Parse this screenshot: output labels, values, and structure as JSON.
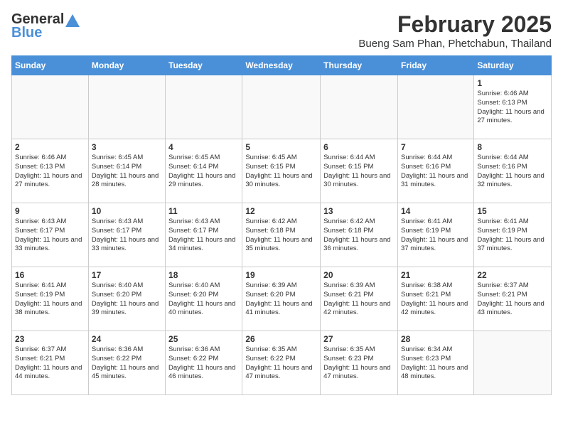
{
  "logo": {
    "general": "General",
    "blue": "Blue"
  },
  "title": "February 2025",
  "subtitle": "Bueng Sam Phan, Phetchabun, Thailand",
  "days_of_week": [
    "Sunday",
    "Monday",
    "Tuesday",
    "Wednesday",
    "Thursday",
    "Friday",
    "Saturday"
  ],
  "weeks": [
    [
      {
        "day": "",
        "info": ""
      },
      {
        "day": "",
        "info": ""
      },
      {
        "day": "",
        "info": ""
      },
      {
        "day": "",
        "info": ""
      },
      {
        "day": "",
        "info": ""
      },
      {
        "day": "",
        "info": ""
      },
      {
        "day": "1",
        "info": "Sunrise: 6:46 AM\nSunset: 6:13 PM\nDaylight: 11 hours and 27 minutes."
      }
    ],
    [
      {
        "day": "2",
        "info": "Sunrise: 6:46 AM\nSunset: 6:13 PM\nDaylight: 11 hours and 27 minutes."
      },
      {
        "day": "3",
        "info": "Sunrise: 6:45 AM\nSunset: 6:14 PM\nDaylight: 11 hours and 28 minutes."
      },
      {
        "day": "4",
        "info": "Sunrise: 6:45 AM\nSunset: 6:14 PM\nDaylight: 11 hours and 29 minutes."
      },
      {
        "day": "5",
        "info": "Sunrise: 6:45 AM\nSunset: 6:15 PM\nDaylight: 11 hours and 30 minutes."
      },
      {
        "day": "6",
        "info": "Sunrise: 6:44 AM\nSunset: 6:15 PM\nDaylight: 11 hours and 30 minutes."
      },
      {
        "day": "7",
        "info": "Sunrise: 6:44 AM\nSunset: 6:16 PM\nDaylight: 11 hours and 31 minutes."
      },
      {
        "day": "8",
        "info": "Sunrise: 6:44 AM\nSunset: 6:16 PM\nDaylight: 11 hours and 32 minutes."
      }
    ],
    [
      {
        "day": "9",
        "info": "Sunrise: 6:43 AM\nSunset: 6:17 PM\nDaylight: 11 hours and 33 minutes."
      },
      {
        "day": "10",
        "info": "Sunrise: 6:43 AM\nSunset: 6:17 PM\nDaylight: 11 hours and 33 minutes."
      },
      {
        "day": "11",
        "info": "Sunrise: 6:43 AM\nSunset: 6:17 PM\nDaylight: 11 hours and 34 minutes."
      },
      {
        "day": "12",
        "info": "Sunrise: 6:42 AM\nSunset: 6:18 PM\nDaylight: 11 hours and 35 minutes."
      },
      {
        "day": "13",
        "info": "Sunrise: 6:42 AM\nSunset: 6:18 PM\nDaylight: 11 hours and 36 minutes."
      },
      {
        "day": "14",
        "info": "Sunrise: 6:41 AM\nSunset: 6:19 PM\nDaylight: 11 hours and 37 minutes."
      },
      {
        "day": "15",
        "info": "Sunrise: 6:41 AM\nSunset: 6:19 PM\nDaylight: 11 hours and 37 minutes."
      }
    ],
    [
      {
        "day": "16",
        "info": "Sunrise: 6:41 AM\nSunset: 6:19 PM\nDaylight: 11 hours and 38 minutes."
      },
      {
        "day": "17",
        "info": "Sunrise: 6:40 AM\nSunset: 6:20 PM\nDaylight: 11 hours and 39 minutes."
      },
      {
        "day": "18",
        "info": "Sunrise: 6:40 AM\nSunset: 6:20 PM\nDaylight: 11 hours and 40 minutes."
      },
      {
        "day": "19",
        "info": "Sunrise: 6:39 AM\nSunset: 6:20 PM\nDaylight: 11 hours and 41 minutes."
      },
      {
        "day": "20",
        "info": "Sunrise: 6:39 AM\nSunset: 6:21 PM\nDaylight: 11 hours and 42 minutes."
      },
      {
        "day": "21",
        "info": "Sunrise: 6:38 AM\nSunset: 6:21 PM\nDaylight: 11 hours and 42 minutes."
      },
      {
        "day": "22",
        "info": "Sunrise: 6:37 AM\nSunset: 6:21 PM\nDaylight: 11 hours and 43 minutes."
      }
    ],
    [
      {
        "day": "23",
        "info": "Sunrise: 6:37 AM\nSunset: 6:21 PM\nDaylight: 11 hours and 44 minutes."
      },
      {
        "day": "24",
        "info": "Sunrise: 6:36 AM\nSunset: 6:22 PM\nDaylight: 11 hours and 45 minutes."
      },
      {
        "day": "25",
        "info": "Sunrise: 6:36 AM\nSunset: 6:22 PM\nDaylight: 11 hours and 46 minutes."
      },
      {
        "day": "26",
        "info": "Sunrise: 6:35 AM\nSunset: 6:22 PM\nDaylight: 11 hours and 47 minutes."
      },
      {
        "day": "27",
        "info": "Sunrise: 6:35 AM\nSunset: 6:23 PM\nDaylight: 11 hours and 47 minutes."
      },
      {
        "day": "28",
        "info": "Sunrise: 6:34 AM\nSunset: 6:23 PM\nDaylight: 11 hours and 48 minutes."
      },
      {
        "day": "",
        "info": ""
      }
    ]
  ]
}
